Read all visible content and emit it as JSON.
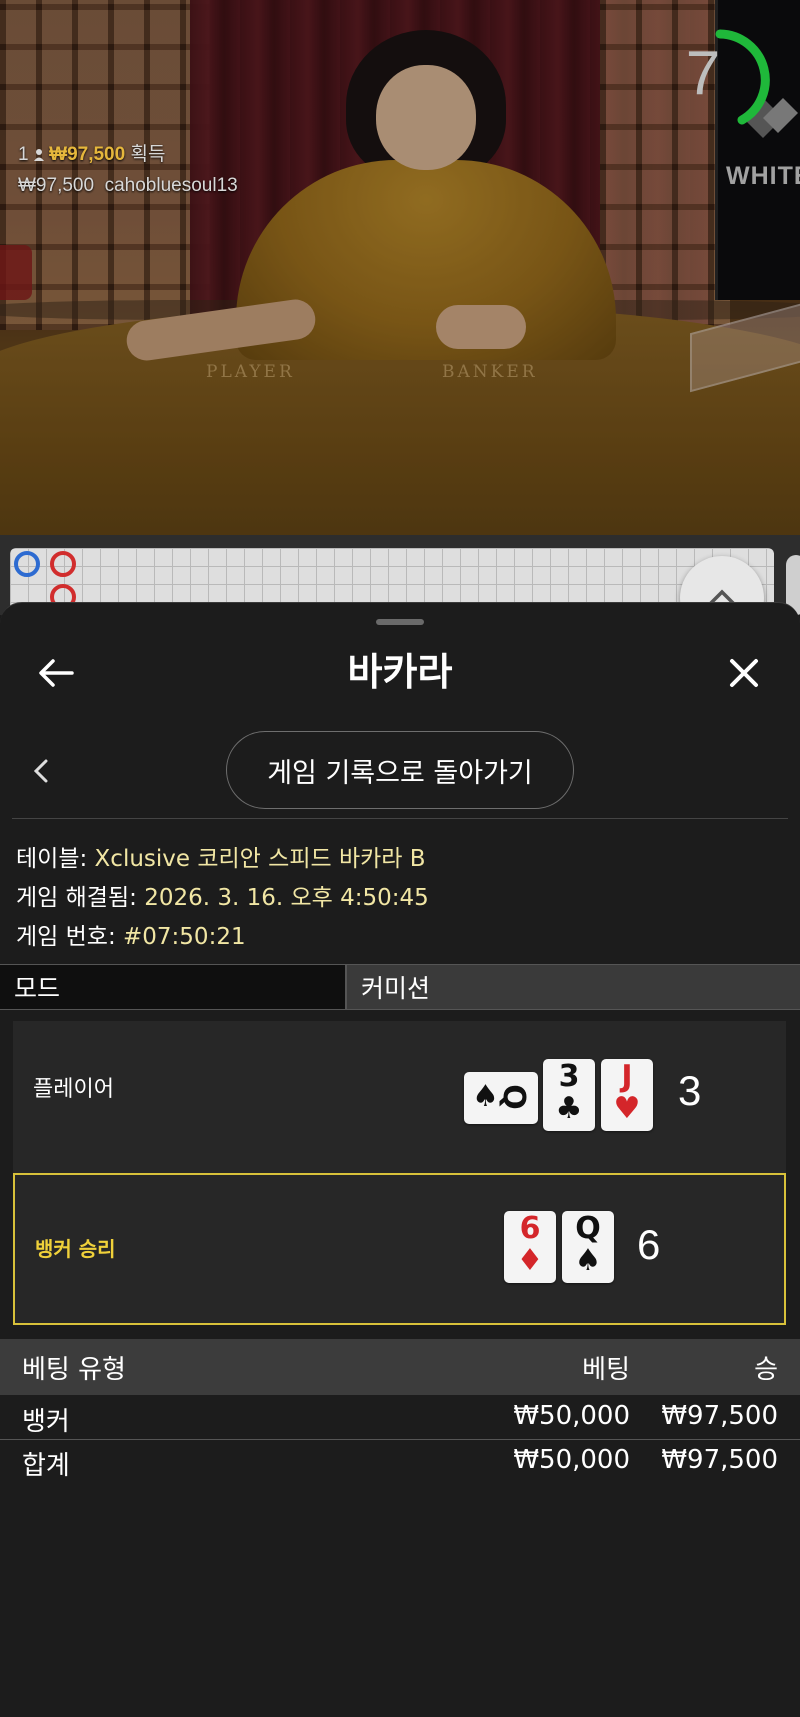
{
  "video": {
    "timer": "7",
    "table_brand": "WHITE",
    "felt_player": "PLAYER",
    "felt_banker": "BANKER",
    "winner_count": "1",
    "winner_amount": "₩97,500",
    "winner_suffix": "획득",
    "win_amount": "₩97,500",
    "win_user": "cahobluesoul13"
  },
  "sheet": {
    "title": "바카라",
    "back_to_history": "게임 기록으로 돌아가기",
    "table_label": "테이블:",
    "table_value": "Xclusive 코리안 스피드 바카라 B",
    "resolved_label": "게임 해결됨:",
    "resolved_value": "2026. 3. 16. 오후 4:50:45",
    "game_no_label": "게임 번호:",
    "game_no_value": "#07:50:21",
    "mode_label": "모드",
    "mode_value": "커미션"
  },
  "player_hand": {
    "label": "플레이어",
    "cards": [
      {
        "rank": "Q",
        "suit": "♠",
        "color": "black",
        "rotated": true
      },
      {
        "rank": "3",
        "suit": "♣",
        "color": "black",
        "rotated": false
      },
      {
        "rank": "J",
        "suit": "♥",
        "color": "red",
        "rotated": false
      }
    ],
    "score": "3"
  },
  "banker_hand": {
    "label": "뱅커 승리",
    "cards": [
      {
        "rank": "6",
        "suit": "♦",
        "color": "red"
      },
      {
        "rank": "Q",
        "suit": "♠",
        "color": "black"
      }
    ],
    "score": "6"
  },
  "bets": {
    "headers": {
      "type": "베팅 유형",
      "bet": "베팅",
      "win": "승"
    },
    "rows": [
      {
        "type": "뱅커",
        "bet": "₩50,000",
        "win": "₩97,500"
      }
    ],
    "total": {
      "type": "합계",
      "bet": "₩50,000",
      "win": "₩97,500"
    }
  },
  "colors": {
    "gold": "#f0d13a",
    "info_value": "#f1e6a4",
    "sheet_bg": "#1c1c1c",
    "timer_green": "#1fb83a"
  }
}
